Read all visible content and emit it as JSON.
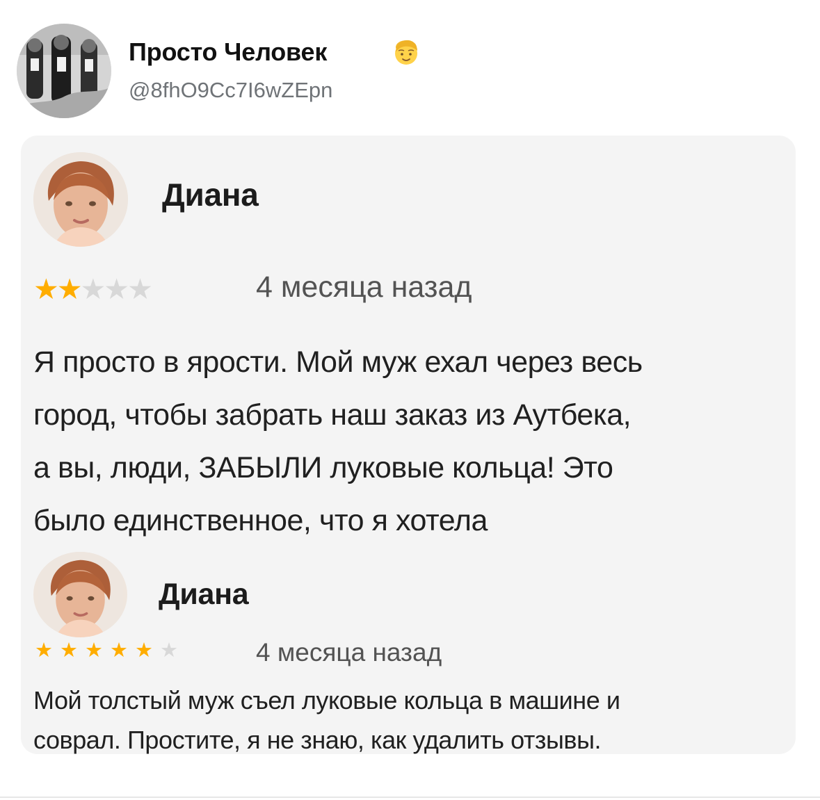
{
  "post": {
    "author": {
      "display_name": "Просто Человек",
      "handle": "@8fhO9Cc7I6wZEpn",
      "avatar_icon": "group-photo-avatar",
      "name_emoji": "man-emoji"
    }
  },
  "reviews": [
    {
      "reviewer_name": "Диана",
      "avatar_icon": "woman-portrait-avatar",
      "rating": 2,
      "max_rating": 5,
      "time_ago": "4 месяца назад",
      "text_lines": [
        "Я просто в ярости. Мой муж ехал через весь",
        "город, чтобы забрать наш заказ из Аутбека,",
        "а вы, люди, ЗАБЫЛИ луковые кольца! Это",
        "было единственное, что я хотела"
      ]
    },
    {
      "reviewer_name": "Диана",
      "avatar_icon": "woman-portrait-avatar",
      "rating": 5,
      "max_rating": 6,
      "time_ago": "4 месяца назад",
      "text_lines": [
        "Мой толстый муж съел луковые кольца в машине и",
        "соврал. Простите, я не знаю, как удалить отзывы."
      ]
    }
  ],
  "colors": {
    "star_on": "#ffad00",
    "star_off": "#d8d8d8",
    "card_background": "#f4f4f4",
    "handle": "#6f7377"
  }
}
